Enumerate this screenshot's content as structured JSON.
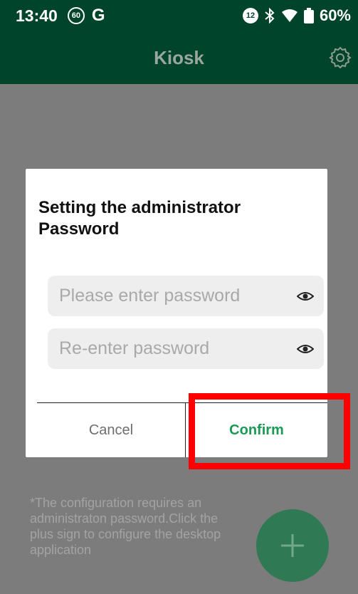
{
  "status_bar": {
    "time": "13:40",
    "badge_left": "60",
    "carrier_glyph": "G",
    "badge_right": "12",
    "battery_text": "60%",
    "icons": [
      "bluetooth-icon",
      "wifi-icon",
      "battery-icon"
    ]
  },
  "app_bar": {
    "title": "Kiosk",
    "settings_icon": "gear-icon"
  },
  "dialog": {
    "title": "Setting the administrator Password",
    "password_placeholder": "Please enter password",
    "password_value": "",
    "reenter_placeholder": "Re-enter password",
    "reenter_value": "",
    "cancel_label": "Cancel",
    "confirm_label": "Confirm"
  },
  "hint_text": "*The configuration requires an administraton password.Click the plus sign to configure the desktop application",
  "fab_icon": "plus-icon",
  "colors": {
    "app_bar": "#00452b",
    "accent": "#1a9a54",
    "overlay": "#7c7c7c",
    "highlight": "#ff0000"
  }
}
